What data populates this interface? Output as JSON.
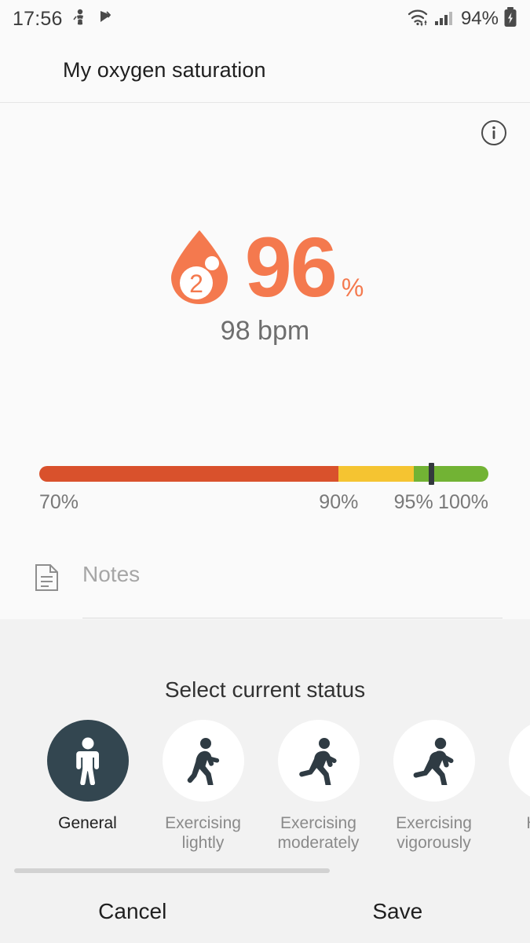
{
  "status_bar": {
    "time": "17:56",
    "battery_text": "94%",
    "icons": [
      "notification-icon",
      "notification-icon",
      "wifi-icon",
      "signal-icon",
      "battery-charging-icon"
    ]
  },
  "header": {
    "title": "My oxygen saturation",
    "info_icon": "info-icon"
  },
  "reading": {
    "droplet_icon": "o2-droplet-icon",
    "droplet_label": "2",
    "value": "96",
    "unit": "%",
    "secondary": "98 bpm",
    "accent_color": "#f4794e"
  },
  "range_bar": {
    "marker_percent": 96,
    "segments": [
      {
        "name": "low",
        "from": 70,
        "to": 90,
        "color": "#d9512c"
      },
      {
        "name": "medium",
        "from": 90,
        "to": 95,
        "color": "#f5c431"
      },
      {
        "name": "normal",
        "from": 95,
        "to": 100,
        "color": "#72b334"
      }
    ],
    "labels": [
      {
        "text": "70%",
        "value": 70
      },
      {
        "text": "90%",
        "value": 90
      },
      {
        "text": "95%",
        "value": 95
      },
      {
        "text": "100%",
        "value": 100
      }
    ]
  },
  "notes": {
    "icon": "note-document-icon",
    "placeholder": "Notes",
    "value": ""
  },
  "picker": {
    "title": "Select current status",
    "selected_index": 0,
    "items": [
      {
        "label": "General",
        "icon": "person-standing-icon",
        "selected": true
      },
      {
        "label": "Exercising\nlightly",
        "icon": "person-walking-icon",
        "selected": false
      },
      {
        "label": "Exercising\nmoderately",
        "icon": "person-jogging-icon",
        "selected": false
      },
      {
        "label": "Exercising\nvigorously",
        "icon": "person-running-icon",
        "selected": false
      },
      {
        "label": "Hiking",
        "icon": "person-hiking-icon",
        "selected": false
      }
    ]
  },
  "footer": {
    "cancel_label": "Cancel",
    "save_label": "Save"
  }
}
